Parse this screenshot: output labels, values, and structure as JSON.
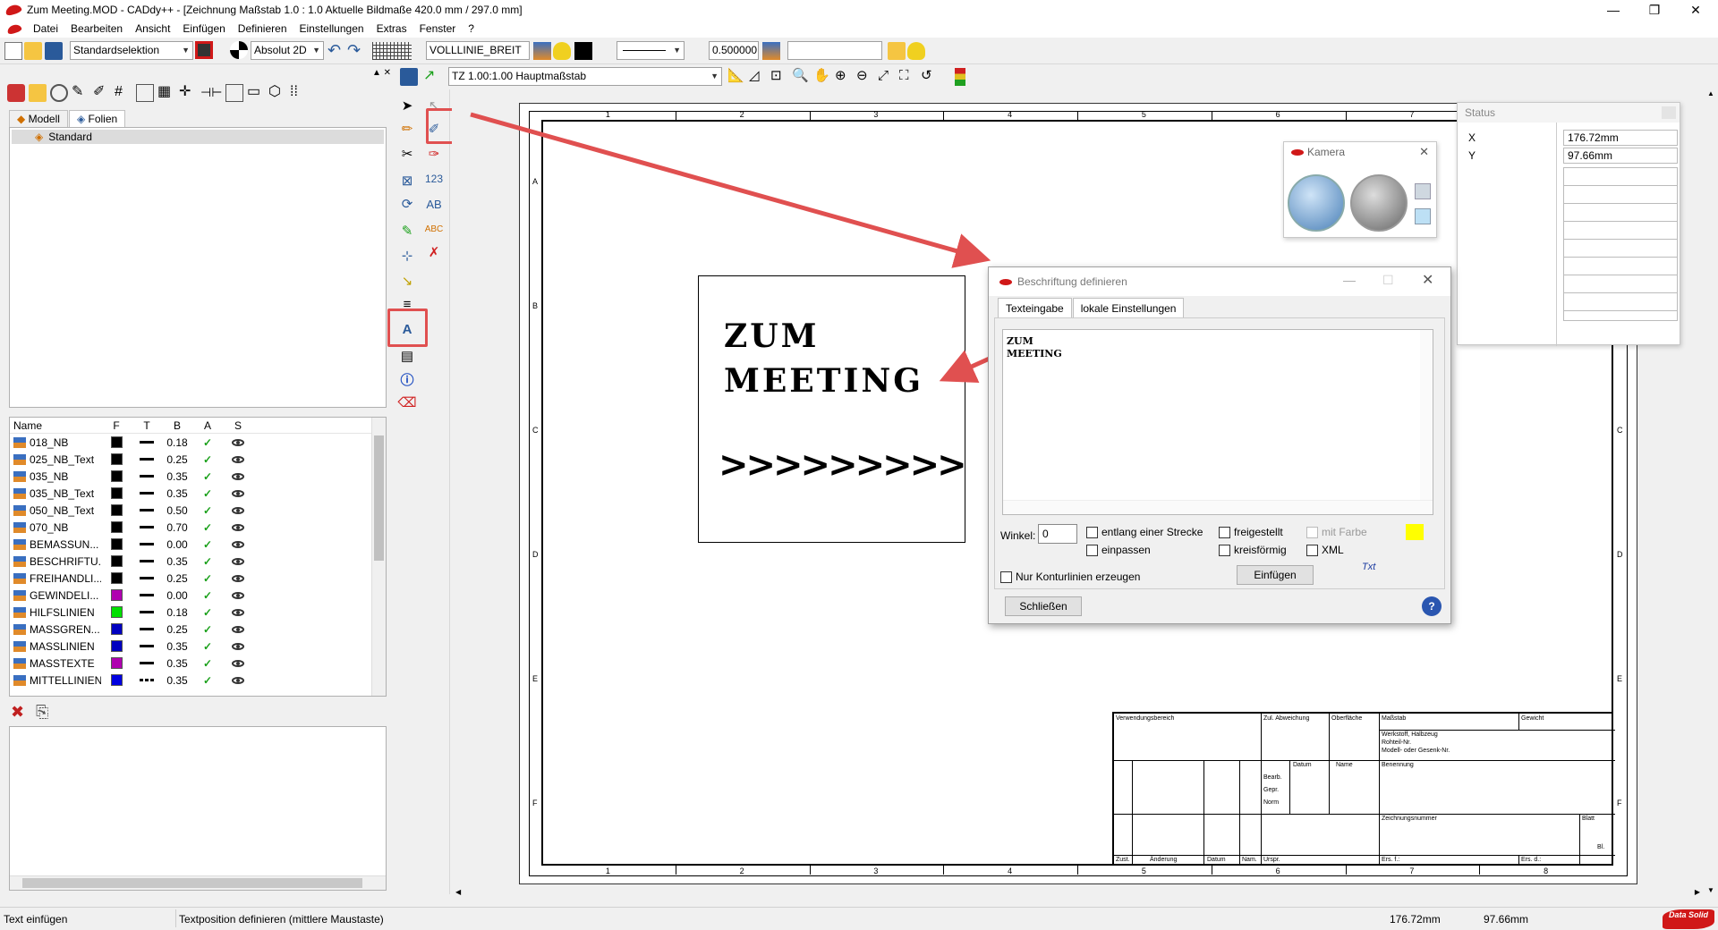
{
  "window": {
    "title": "Zum Meeting.MOD  -  CADdy++ - [Zeichnung   Maßstab 1.0 : 1.0   Aktuelle Bildmaße 420.0 mm / 297.0 mm]",
    "minimize": "—",
    "restore": "❐",
    "close": "✕"
  },
  "menu": [
    "Datei",
    "Bearbeiten",
    "Ansicht",
    "Einfügen",
    "Definieren",
    "Einstellungen",
    "Extras",
    "Fenster",
    "?"
  ],
  "toolbar": {
    "selection_mode": "Standardselektion",
    "coord_mode": "Absolut 2D",
    "line_type": "VOLLLINIE_BREIT",
    "line_width": "0.500000",
    "text_field": ""
  },
  "toolbar2": {
    "scale_combo": "TZ 1.00:1.00 Hauptmaßstab"
  },
  "left_panel": {
    "tabs": [
      "Modell",
      "Folien"
    ],
    "tree_item": "Standard",
    "columns": [
      "Name",
      "F",
      "T",
      "B",
      "A",
      "S"
    ],
    "layers": [
      {
        "name": "018_NB",
        "color": "#000000",
        "line": "solid",
        "b": "0.18"
      },
      {
        "name": "025_NB_Text",
        "color": "#000000",
        "line": "solid",
        "b": "0.25"
      },
      {
        "name": "035_NB",
        "color": "#000000",
        "line": "solid",
        "b": "0.35"
      },
      {
        "name": "035_NB_Text",
        "color": "#000000",
        "line": "solid",
        "b": "0.35"
      },
      {
        "name": "050_NB_Text",
        "color": "#000000",
        "line": "solid",
        "b": "0.50"
      },
      {
        "name": "070_NB",
        "color": "#000000",
        "line": "solid",
        "b": "0.70"
      },
      {
        "name": "BEMASSUN...",
        "color": "#000000",
        "line": "solid",
        "b": "0.00"
      },
      {
        "name": "BESCHRIFTU...",
        "color": "#000000",
        "line": "solid",
        "b": "0.35"
      },
      {
        "name": "FREIHANDLI...",
        "color": "#000000",
        "line": "solid",
        "b": "0.25"
      },
      {
        "name": "GEWINDELI...",
        "color": "#b000b0",
        "line": "solid",
        "b": "0.00"
      },
      {
        "name": "HILFSLINIEN",
        "color": "#00e000",
        "line": "solid",
        "b": "0.18"
      },
      {
        "name": "MASSGREN...",
        "color": "#0000c0",
        "line": "solid",
        "b": "0.25"
      },
      {
        "name": "MASSLINIEN",
        "color": "#0000c0",
        "line": "solid",
        "b": "0.35"
      },
      {
        "name": "MASSTEXTE",
        "color": "#b000b0",
        "line": "solid",
        "b": "0.35"
      },
      {
        "name": "MITTELLINIEN",
        "color": "#0000e0",
        "line": "dash",
        "b": "0.35"
      }
    ]
  },
  "drawing": {
    "text_line1": "ZUM",
    "text_line2": "MEETING",
    "arrows": ">>>>>>>>>",
    "col_labels": [
      "1",
      "2",
      "3",
      "4",
      "5",
      "6",
      "7",
      "8"
    ],
    "row_labels": [
      "A",
      "B",
      "C",
      "D",
      "E",
      "F"
    ],
    "title_block": {
      "verwendung": "Verwendungsbereich",
      "zul_abw": "Zul. Abweichung",
      "oberflaeche": "Oberfläche",
      "massstab": "Maßstab",
      "gewicht": "Gewicht",
      "werkstoff": "Werkstoff, Halbzeug",
      "rohteil": "Rohteil-Nr.",
      "modell": "Modell- oder Gesenk-Nr.",
      "datum": "Datum",
      "name": "Name",
      "bearb": "Bearb.",
      "gepr": "Gepr.",
      "norm": "Norm",
      "benennung": "Benennung",
      "zeichnungsnummer": "Zeichnungsnummer",
      "blatt": "Blatt",
      "bl": "Bl.",
      "zust": "Zust.",
      "aenderung": "Änderung",
      "datum2": "Datum",
      "nam": "Nam.",
      "urspr": "Urspr.",
      "ers_f": "Ers. f.:",
      "ers_d": "Ers. d.:"
    }
  },
  "camera": {
    "title": "Kamera",
    "close": "✕"
  },
  "status_panel": {
    "title": "Status",
    "x_label": "X",
    "x_value": "176.72mm",
    "y_label": "Y",
    "y_value": "97.66mm"
  },
  "dialog": {
    "title": "Beschriftung definieren",
    "tabs": [
      "Texteingabe",
      "lokale Einstellungen"
    ],
    "text_line1": "ZUM",
    "text_line2": "MEETING",
    "winkel_label": "Winkel:",
    "winkel_value": "0",
    "entlang": "entlang einer Strecke",
    "einpassen": "einpassen",
    "freigestellt": "freigestellt",
    "kreisfoermig": "kreisförmig",
    "mit_farbe": "mit Farbe",
    "xml": "XML",
    "nur_kontur": "Nur Konturlinien erzeugen",
    "einfuegen": "Einfügen",
    "txt": "Txt",
    "schliessen": "Schließen",
    "help": "?",
    "color_swatch": "#ffff00"
  },
  "statusbar": {
    "left": "Text einfügen",
    "middle": "Textposition definieren (mittlere Maustaste)",
    "x": "176.72mm",
    "y": "97.66mm",
    "logo": "Data Solid"
  },
  "colors": {
    "accent_red": "#e05050",
    "app_red": "#d01818"
  }
}
